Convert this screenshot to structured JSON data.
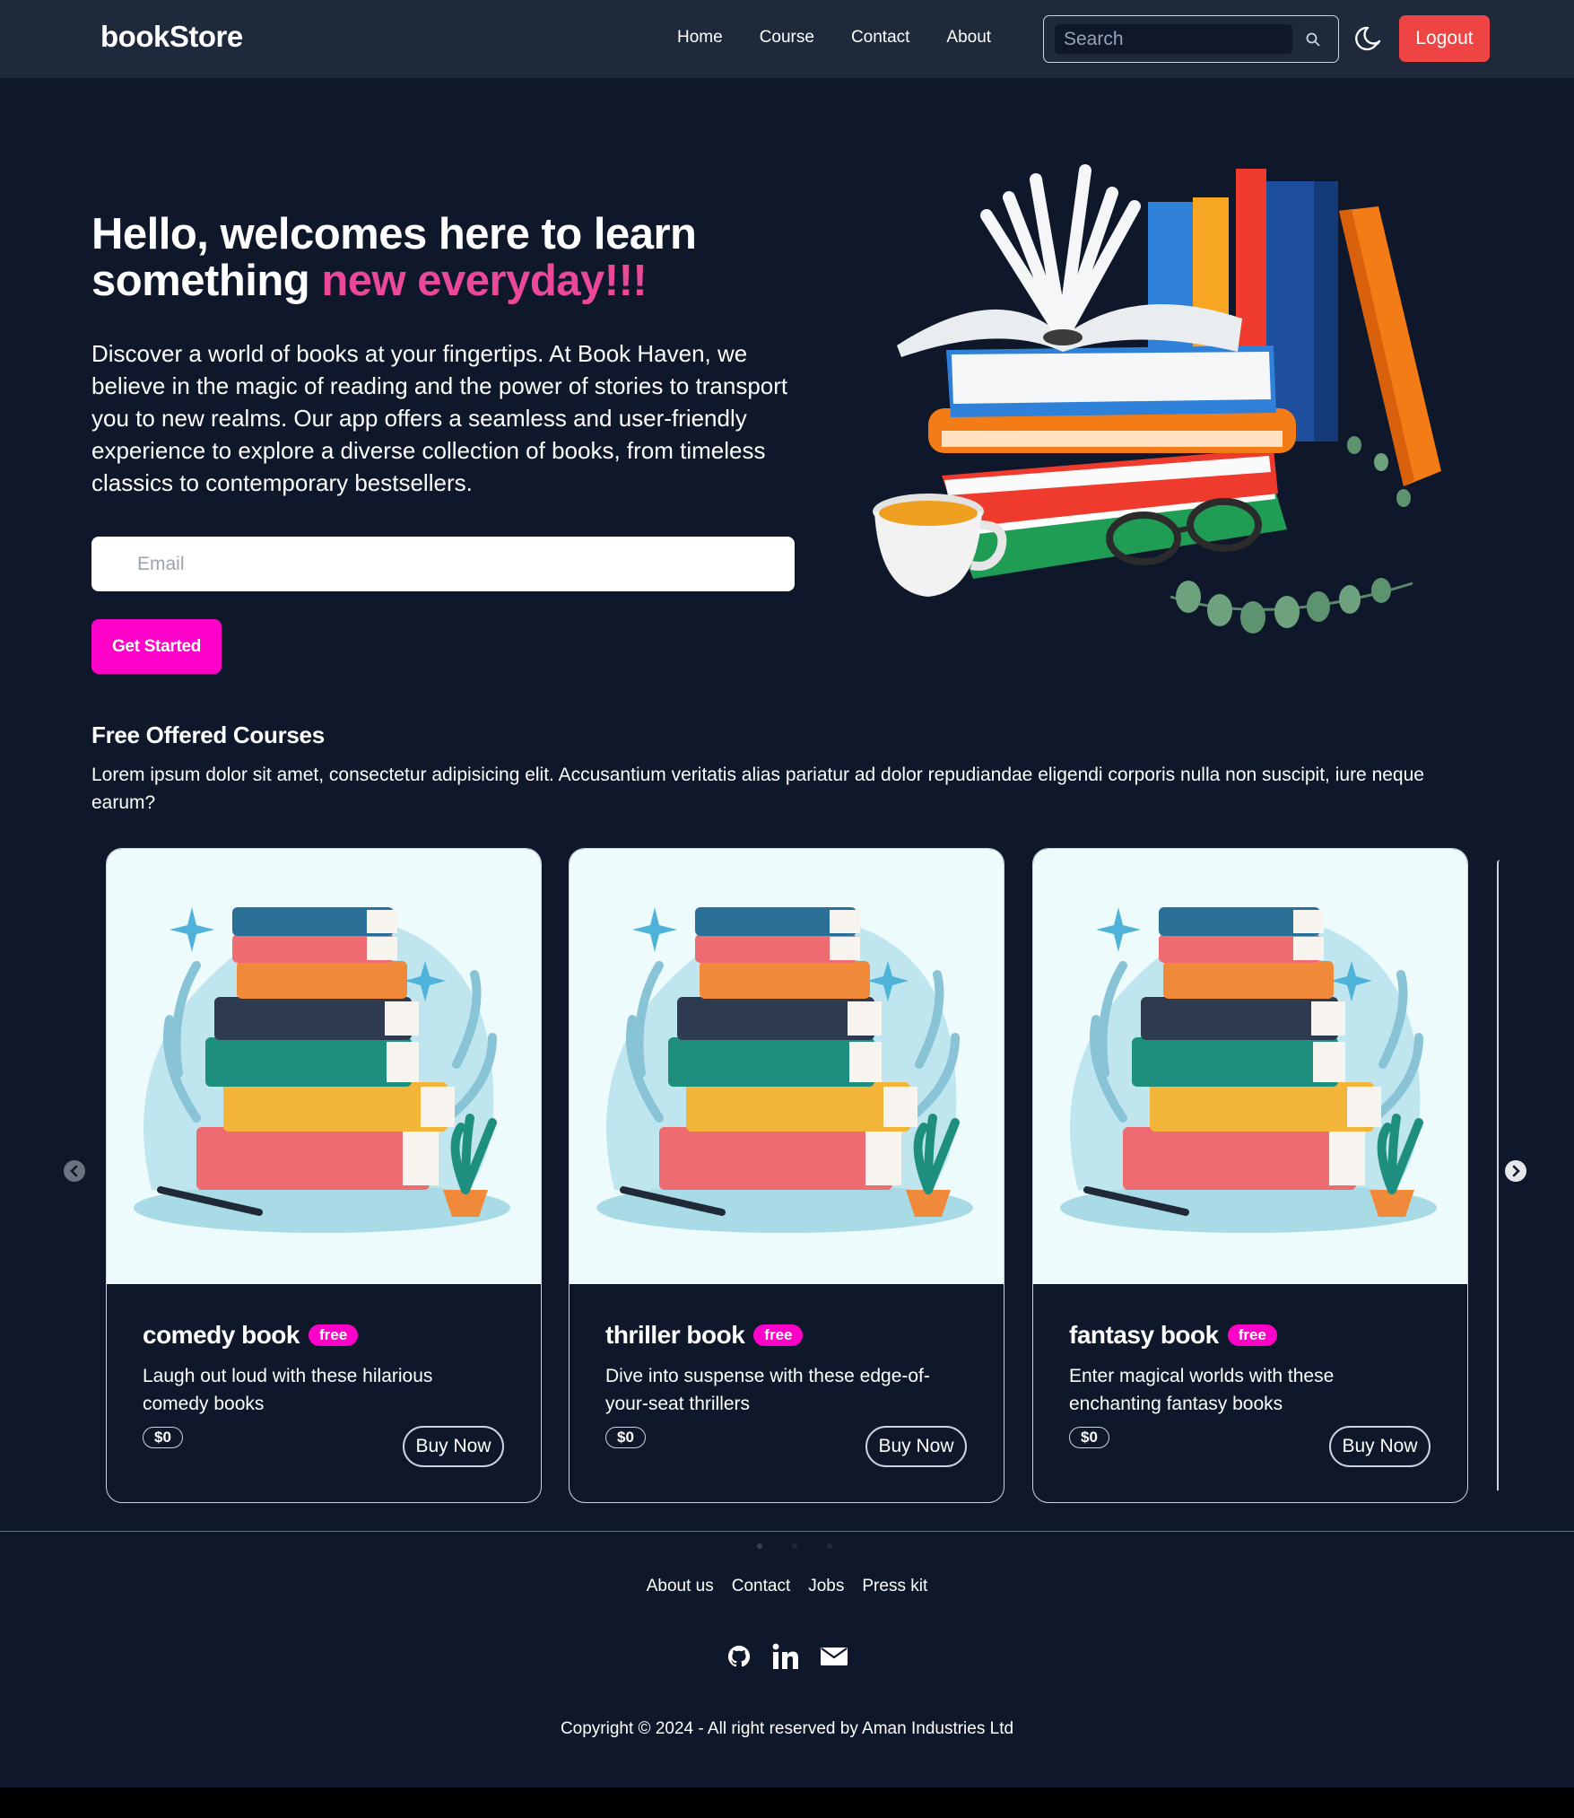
{
  "navbar": {
    "brand": "bookStore",
    "links": [
      "Home",
      "Course",
      "Contact",
      "About"
    ],
    "search_placeholder": "Search",
    "logout_label": "Logout"
  },
  "hero": {
    "title_part1": "Hello, welcomes here to learn something ",
    "title_accent": "new everyday!!!",
    "description": "Discover a world of books at your fingertips. At Book Haven, we believe in the magic of reading and the power of stories to transport you to new realms. Our app offers a seamless and user-friendly experience to explore a diverse collection of books, from timeless classics to contemporary bestsellers.",
    "email_placeholder": "Email",
    "cta_label": "Get Started"
  },
  "courses": {
    "title": "Free Offered Courses",
    "description": "Lorem ipsum dolor sit amet, consectetur adipisicing elit. Accusantium veritatis alias pariatur ad dolor repudiandae eligendi corporis nulla non suscipit, iure neque earum?",
    "cards": [
      {
        "title": "comedy book",
        "badge": "free",
        "text": "Laugh out loud with these hilarious comedy books",
        "price": "$0",
        "button": "Buy Now"
      },
      {
        "title": "thriller book",
        "badge": "free",
        "text": "Dive into suspense with these edge-of-your-seat thrillers",
        "price": "$0",
        "button": "Buy Now"
      },
      {
        "title": "fantasy book",
        "badge": "free",
        "text": "Enter magical worlds with these enchanting fantasy books",
        "price": "$0",
        "button": "Buy Now"
      }
    ]
  },
  "footer": {
    "links": [
      "About us",
      "Contact",
      "Jobs",
      "Press kit"
    ],
    "social_icons": [
      "github-icon",
      "linkedin-icon",
      "mail-icon"
    ],
    "copyright": "Copyright © 2024 - All right reserved by Aman Industries Ltd"
  },
  "colors": {
    "background": "#0f172a",
    "navbar": "#1e293b",
    "accent_pink": "#ec4899",
    "cta_magenta": "#ff00c8",
    "logout_red": "#ef4444"
  }
}
